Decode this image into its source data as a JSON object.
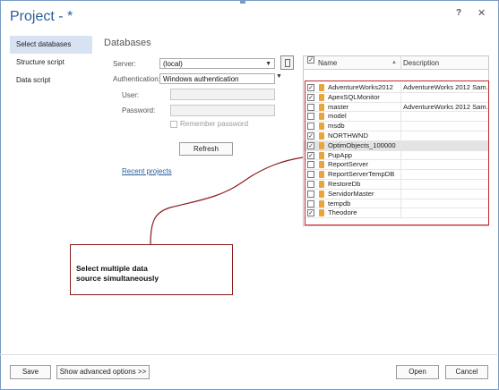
{
  "window": {
    "title": "Project - *",
    "help": "?",
    "close": "✕"
  },
  "nav": {
    "items": [
      {
        "label": "Select databases"
      },
      {
        "label": "Structure script"
      },
      {
        "label": "Data script"
      }
    ]
  },
  "section_title": "Databases",
  "form": {
    "server_label": "Server:",
    "server_value": "(local)",
    "auth_label": "Authentication:",
    "auth_value": "Windows authentication",
    "user_label": "User:",
    "user_value": "",
    "password_label": "Password:",
    "password_value": "",
    "remember_label": "Remember password",
    "refresh_label": "Refresh",
    "recent_link": "Recent projects"
  },
  "grid": {
    "header_name": "Name",
    "header_description": "Description",
    "rows": [
      {
        "name": "AdventureWorks2012",
        "description": "AdventureWorks 2012 Sam...",
        "checked": true
      },
      {
        "name": "ApexSQLMonitor",
        "description": "",
        "checked": true
      },
      {
        "name": "master",
        "description": "AdventureWorks 2012 Sam...",
        "checked": false
      },
      {
        "name": "model",
        "description": "",
        "checked": false
      },
      {
        "name": "msdb",
        "description": "",
        "checked": false
      },
      {
        "name": "NORTHWND",
        "description": "",
        "checked": true
      },
      {
        "name": "OptimObjects_100000",
        "description": "",
        "checked": true,
        "highlight": true
      },
      {
        "name": "PupApp",
        "description": "",
        "checked": true
      },
      {
        "name": "ReportServer",
        "description": "",
        "checked": false
      },
      {
        "name": "ReportServerTempDB",
        "description": "",
        "checked": false
      },
      {
        "name": "RestoreDb",
        "description": "",
        "checked": false
      },
      {
        "name": "ServidorMaster",
        "description": "",
        "checked": false
      },
      {
        "name": "tempdb",
        "description": "",
        "checked": false
      },
      {
        "name": "Theodore",
        "description": "",
        "checked": true
      }
    ]
  },
  "callout": {
    "line1": "Select multiple data",
    "line2": "source simultaneously"
  },
  "footer": {
    "save": "Save",
    "advanced": "Show advanced options >>",
    "open": "Open",
    "cancel": "Cancel"
  },
  "colors": {
    "accent": "#2a5d98",
    "highlight": "#c0282e",
    "callout_border": "#8b1a1a"
  }
}
